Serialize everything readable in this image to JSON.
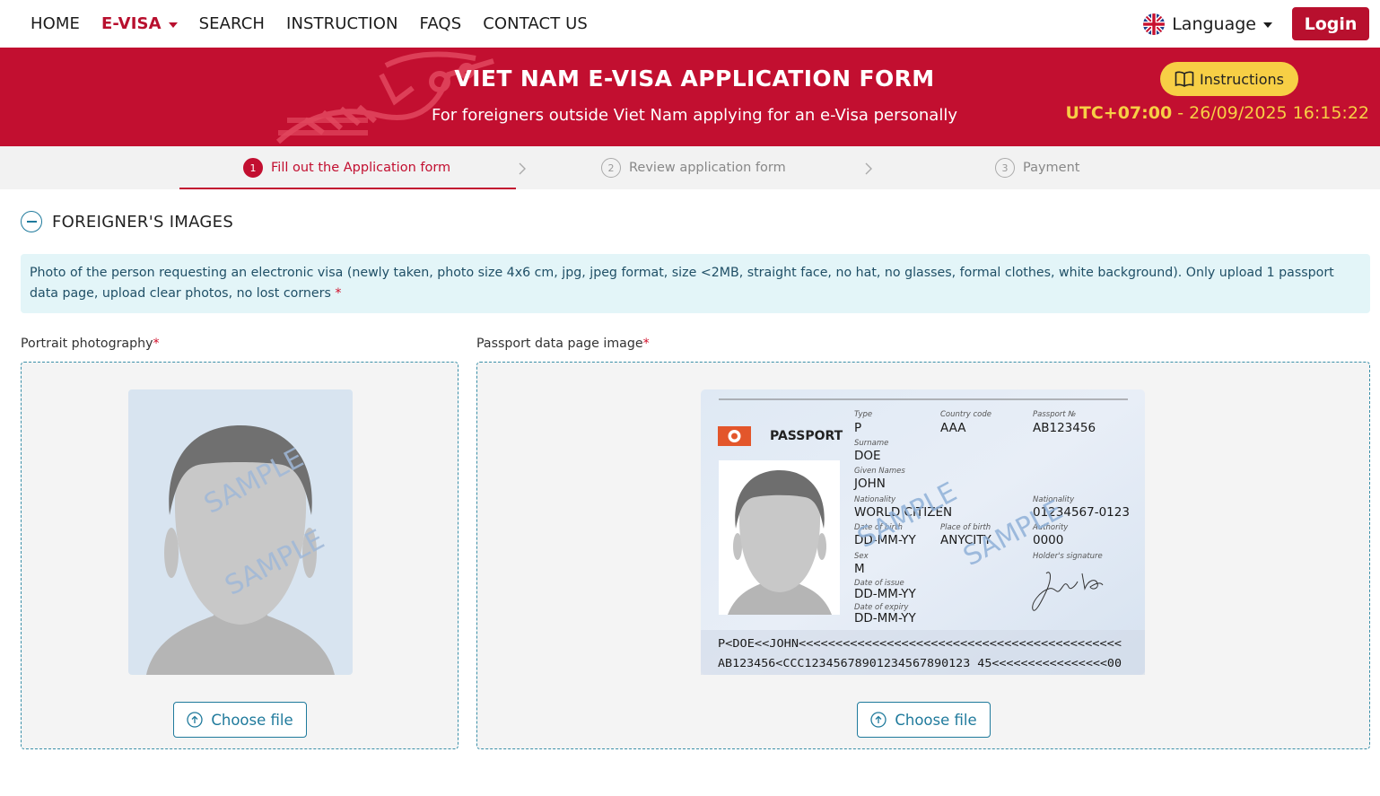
{
  "nav": {
    "links": [
      {
        "label": "HOME",
        "active": false
      },
      {
        "label": "E-VISA",
        "active": true,
        "dropdown": true
      },
      {
        "label": "SEARCH",
        "active": false
      },
      {
        "label": "INSTRUCTION",
        "active": false
      },
      {
        "label": "FAQS",
        "active": false
      },
      {
        "label": "CONTACT US",
        "active": false
      }
    ],
    "language_label": "Language",
    "login_label": "Login"
  },
  "banner": {
    "title": "VIET NAM E-VISA APPLICATION FORM",
    "subtitle": "For foreigners outside Viet Nam applying for an e-Visa personally",
    "instructions_label": "Instructions",
    "timezone": "UTC+07:00",
    "datetime": " - 26/09/2025 16:15:22"
  },
  "steps": [
    {
      "num": "1",
      "label": "Fill out the Application form",
      "active": true
    },
    {
      "num": "2",
      "label": "Review application form",
      "active": false
    },
    {
      "num": "3",
      "label": "Payment",
      "active": false
    }
  ],
  "section": {
    "title": "FOREIGNER'S IMAGES",
    "notice": "Photo of the person requesting an electronic visa (newly taken, photo size 4x6 cm, jpg, jpeg format, size <2MB, straight face, no hat, no glasses, formal clothes, white background). Only upload 1 passport data page, upload clear photos, no lost corners",
    "required_mark": "*"
  },
  "portrait": {
    "label": "Portrait photography",
    "watermark": "SAMPLE",
    "button_label": "Choose file"
  },
  "passport": {
    "label": "Passport data page image",
    "button_label": "Choose file",
    "watermark": "SAMPLE",
    "heading": "PASSPORT",
    "type_label": "Type",
    "type_value": "P",
    "country_label": "Country code",
    "country_value": "AAA",
    "number_label": "Passport №",
    "number_value": "AB123456",
    "surname_label": "Surname",
    "surname_value": "DOE",
    "given_label": "Given Names",
    "given_value": "JOHN",
    "nationality_label": "Nationality",
    "nationality_value": "WORLD CITIZEN",
    "personal_label": "Nationality",
    "personal_value": "01234567-0123",
    "dob_label": "Date of birth",
    "dob_value": "DD-MM-YY",
    "pob_label": "Place of birth",
    "pob_value": "ANYCITY",
    "authority_label": "Authority",
    "authority_value": "0000",
    "sex_label": "Sex",
    "sex_value": "M",
    "signature_label": "Holder's signature",
    "signature_value": "John Doe",
    "issue_label": "Date of issue",
    "issue_value": "DD-MM-YY",
    "expiry_label": "Date of expiry",
    "expiry_value": "DD-MM-YY",
    "mrz_line1": "P<DOE<<JOHN<<<<<<<<<<<<<<<<<<<<<<<<<<<<<<<<<<<<<<<<<<<<",
    "mrz_line2": "AB123456<CCC12345678901234567890123 45<<<<<<<<<<<<<<<<00"
  },
  "colors": {
    "brand_red": "#c20f30",
    "accent_yellow": "#f7cf45",
    "teal": "#1f7a9c",
    "notice_bg": "#e3f5f8"
  }
}
